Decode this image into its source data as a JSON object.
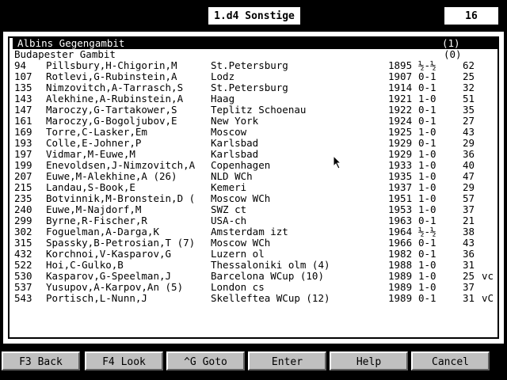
{
  "header": {
    "title": "1.d4 Sonstige",
    "count": "16"
  },
  "openings": [
    {
      "name": "Albins Gegengambit",
      "count": "(1)",
      "selected": true
    },
    {
      "name": "Budapester Gambit",
      "count": "(0)",
      "selected": false
    }
  ],
  "games": [
    {
      "id": "94",
      "players": "Pillsbury,H-Chigorin,M",
      "event": "St.Petersburg",
      "year": "1895",
      "result": "½-½",
      "moves": "62",
      "note": ""
    },
    {
      "id": "107",
      "players": "Rotlevi,G-Rubinstein,A",
      "event": "Lodz",
      "year": "1907",
      "result": "0-1",
      "moves": "25",
      "note": ""
    },
    {
      "id": "135",
      "players": "Nimzovitch,A-Tarrasch,S",
      "event": "St.Petersburg",
      "year": "1914",
      "result": "0-1",
      "moves": "32",
      "note": ""
    },
    {
      "id": "143",
      "players": "Alekhine,A-Rubinstein,A",
      "event": "Haag",
      "year": "1921",
      "result": "1-0",
      "moves": "51",
      "note": ""
    },
    {
      "id": "147",
      "players": "Maroczy,G-Tartakower,S",
      "event": "Teplitz Schoenau",
      "year": "1922",
      "result": "0-1",
      "moves": "35",
      "note": ""
    },
    {
      "id": "161",
      "players": "Maroczy,G-Bogoljubov,E",
      "event": "New York",
      "year": "1924",
      "result": "0-1",
      "moves": "27",
      "note": ""
    },
    {
      "id": "169",
      "players": "Torre,C-Lasker,Em",
      "event": "Moscow",
      "year": "1925",
      "result": "1-0",
      "moves": "43",
      "note": ""
    },
    {
      "id": "193",
      "players": "Colle,E-Johner,P",
      "event": "Karlsbad",
      "year": "1929",
      "result": "0-1",
      "moves": "29",
      "note": ""
    },
    {
      "id": "197",
      "players": "Vidmar,M-Euwe,M",
      "event": "Karlsbad",
      "year": "1929",
      "result": "1-0",
      "moves": "36",
      "note": ""
    },
    {
      "id": "199",
      "players": "Enevoldsen,J-Nimzovitch,A",
      "event": "Copenhagen",
      "year": "1933",
      "result": "1-0",
      "moves": "40",
      "note": ""
    },
    {
      "id": "207",
      "players": "Euwe,M-Alekhine,A (26)",
      "event": "NLD WCh",
      "year": "1935",
      "result": "1-0",
      "moves": "47",
      "note": ""
    },
    {
      "id": "215",
      "players": "Landau,S-Book,E",
      "event": "Kemeri",
      "year": "1937",
      "result": "1-0",
      "moves": "29",
      "note": ""
    },
    {
      "id": "235",
      "players": "Botvinnik,M-Bronstein,D (",
      "event": "Moscow WCh",
      "year": "1951",
      "result": "1-0",
      "moves": "57",
      "note": ""
    },
    {
      "id": "240",
      "players": "Euwe,M-Najdorf,M",
      "event": "SWZ ct",
      "year": "1953",
      "result": "1-0",
      "moves": "37",
      "note": ""
    },
    {
      "id": "299",
      "players": "Byrne,R-Fischer,R",
      "event": "USA-ch",
      "year": "1963",
      "result": "0-1",
      "moves": "21",
      "note": ""
    },
    {
      "id": "302",
      "players": "Foguelman,A-Darga,K",
      "event": "Amsterdam izt",
      "year": "1964",
      "result": "½-½",
      "moves": "38",
      "note": ""
    },
    {
      "id": "315",
      "players": "Spassky,B-Petrosian,T (7)",
      "event": "Moscow WCh",
      "year": "1966",
      "result": "0-1",
      "moves": "43",
      "note": ""
    },
    {
      "id": "432",
      "players": "Korchnoi,V-Kasparov,G",
      "event": "Luzern ol",
      "year": "1982",
      "result": "0-1",
      "moves": "36",
      "note": ""
    },
    {
      "id": "522",
      "players": "Hoi,C-Gulko,B",
      "event": "Thessaloniki olm (4)",
      "year": "1988",
      "result": "1-0",
      "moves": "31",
      "note": ""
    },
    {
      "id": "530",
      "players": "Kasparov,G-Speelman,J",
      "event": "Barcelona WCup (10)",
      "year": "1989",
      "result": "1-0",
      "moves": "25",
      "note": "vc"
    },
    {
      "id": "537",
      "players": "Yusupov,A-Karpov,An (5)",
      "event": "London cs",
      "year": "1989",
      "result": "1-0",
      "moves": "37",
      "note": ""
    },
    {
      "id": "543",
      "players": "Portisch,L-Nunn,J",
      "event": "Skelleftea WCup (12)",
      "year": "1989",
      "result": "0-1",
      "moves": "31",
      "note": "vC"
    }
  ],
  "fkeys": [
    {
      "label": "F3 Back"
    },
    {
      "label": "F4 Look"
    },
    {
      "label": "^G Goto"
    },
    {
      "label": "Enter"
    },
    {
      "label": "Help"
    },
    {
      "label": "Cancel"
    }
  ]
}
